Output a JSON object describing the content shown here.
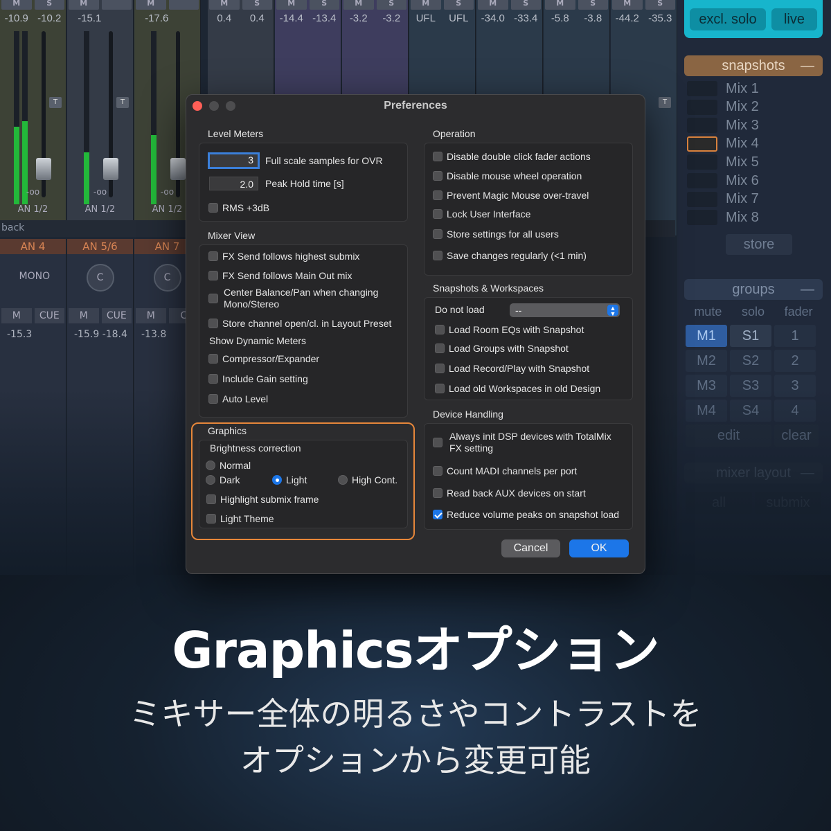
{
  "mixer": {
    "strips": [
      {
        "m": "M",
        "s": "S",
        "l1": "-10.9",
        "l2": "-10.2",
        "db": "-oo",
        "ch": "AN 1/2"
      },
      {
        "m": "M",
        "s": "",
        "l1": "-15.1",
        "l2": "",
        "db": "-oo",
        "ch": "AN 1/2"
      },
      {
        "m": "M",
        "s": "",
        "l1": "-17.6",
        "l2": "",
        "db": "-oo",
        "ch": "AN 1/2"
      },
      {
        "m": "M",
        "s": "S",
        "l1": "0.4",
        "l2": "0.4",
        "db": "",
        "ch": ""
      },
      {
        "m": "M",
        "s": "S",
        "l1": "-14.4",
        "l2": "-13.4",
        "db": "",
        "ch": ""
      },
      {
        "m": "M",
        "s": "S",
        "l1": "-3.2",
        "l2": "-3.2",
        "db": "",
        "ch": ""
      },
      {
        "m": "M",
        "s": "S",
        "l1": "UFL",
        "l2": "UFL",
        "db": "",
        "ch": ""
      },
      {
        "m": "M",
        "s": "S",
        "l1": "-34.0",
        "l2": "-33.4",
        "db": "",
        "ch": ""
      },
      {
        "m": "M",
        "s": "S",
        "l1": "-5.8",
        "l2": "-3.8",
        "db": "",
        "ch": ""
      },
      {
        "m": "M",
        "s": "S",
        "l1": "-44.2",
        "l2": "-35.3",
        "db": "",
        "ch": ""
      }
    ],
    "t_label": "T",
    "back_label": "back",
    "lower": [
      {
        "an": "AN 4",
        "knob": "MONO",
        "m": "M",
        "cue": "CUE",
        "v1": "-15.3",
        "v2": ""
      },
      {
        "an": "AN 5/6",
        "knob": "C",
        "m": "M",
        "cue": "CUE",
        "v1": "-15.9",
        "v2": "-18.4"
      },
      {
        "an": "AN 7",
        "knob": "C",
        "m": "M",
        "cue": "C",
        "v1": "-13.8",
        "v2": ""
      }
    ]
  },
  "right_panel": {
    "excl_solo": "excl. solo",
    "live": "live",
    "snapshots_title": "snapshots",
    "dash": "—",
    "snapshots": [
      "Mix 1",
      "Mix 2",
      "Mix 3",
      "Mix 4",
      "Mix 5",
      "Mix 6",
      "Mix 7",
      "Mix 8"
    ],
    "active_snapshot_index": 3,
    "store": "store",
    "groups_title": "groups",
    "group_cols": [
      "mute",
      "solo",
      "fader"
    ],
    "group_rows": [
      [
        "M1",
        "S1",
        "1"
      ],
      [
        "M2",
        "S2",
        "2"
      ],
      [
        "M3",
        "S3",
        "3"
      ],
      [
        "M4",
        "S4",
        "4"
      ]
    ],
    "edit": "edit",
    "clear": "clear",
    "mixer_layout": "mixer layout",
    "all": "all",
    "submix": "submix"
  },
  "dialog": {
    "title": "Preferences",
    "level_meters": {
      "title": "Level Meters",
      "ovr_value": "3",
      "ovr_label": "Full scale samples for OVR",
      "peak_value": "2.0",
      "peak_label": "Peak Hold time [s]",
      "rms_label": "RMS +3dB"
    },
    "mixer_view": {
      "title": "Mixer View",
      "fx_highest": "FX Send follows highest submix",
      "fx_main": "FX Send follows Main Out mix",
      "center_balance": "Center Balance/Pan when changing Mono/Stereo",
      "store_channel": "Store channel open/cl. in Layout Preset",
      "show_dynamic": "Show Dynamic Meters",
      "compressor": "Compressor/Expander",
      "include_gain": "Include Gain setting",
      "auto_level": "Auto Level"
    },
    "graphics": {
      "title": "Graphics",
      "brightness": "Brightness correction",
      "normal": "Normal",
      "dark": "Dark",
      "light": "Light",
      "high_cont": "High Cont.",
      "highlight_submix": "Highlight submix frame",
      "light_theme": "Light Theme"
    },
    "operation": {
      "title": "Operation",
      "items": [
        "Disable double click fader actions",
        "Disable mouse wheel operation",
        "Prevent Magic Mouse over-travel",
        "Lock User Interface",
        "Store settings for all users",
        "Save changes regularly (<1 min)"
      ]
    },
    "snapshots_ws": {
      "title": "Snapshots & Workspaces",
      "do_not_load": "Do not load",
      "select_value": "--",
      "items": [
        "Load Room EQs with Snapshot",
        "Load Groups with Snapshot",
        "Load Record/Play with Snapshot",
        "Load old Workspaces in old Design"
      ]
    },
    "device": {
      "title": "Device Handling",
      "always_init": "Always init DSP devices with TotalMix FX setting",
      "count_madi": "Count MADI channels per port",
      "read_back": "Read back AUX devices on start",
      "reduce_volume": "Reduce volume peaks on snapshot load"
    },
    "cancel": "Cancel",
    "ok": "OK"
  },
  "headline": "Graphicsオプション",
  "subline1": "ミキサー全体の明るさやコントラストを",
  "subline2": "オプションから変更可能",
  "colors": {
    "accent_blue": "#1c76e8",
    "highlight_orange": "#e7873a",
    "cyan": "#17b5cc"
  }
}
